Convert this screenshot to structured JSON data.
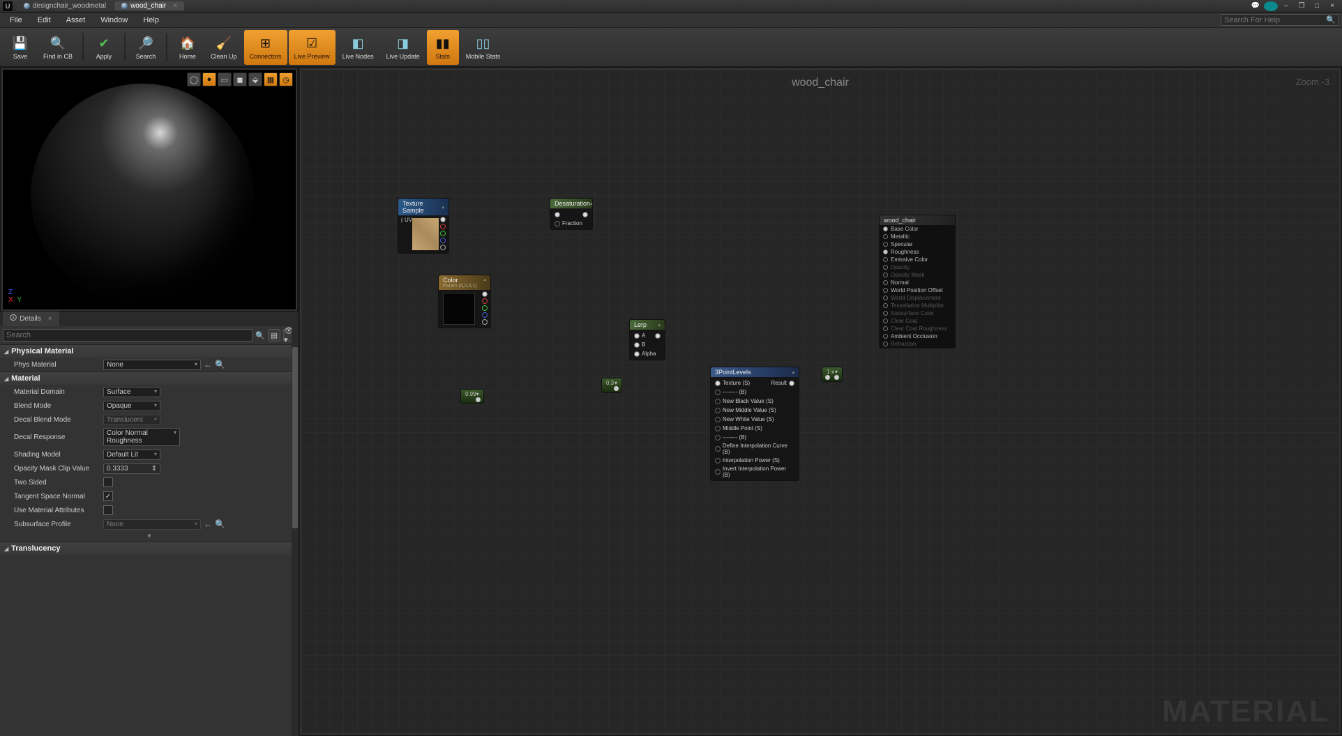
{
  "titlebar": {
    "tabs": [
      {
        "label": "designchair_woodmetal",
        "active": false
      },
      {
        "label": "wood_chair",
        "active": true
      }
    ]
  },
  "menubar": {
    "items": [
      "File",
      "Edit",
      "Asset",
      "Window",
      "Help"
    ],
    "search_placeholder": "Search For Help"
  },
  "toolbar": {
    "buttons": [
      {
        "label": "Save",
        "icon": "💾",
        "active": false
      },
      {
        "label": "Find in CB",
        "icon": "🔍",
        "active": false
      },
      {
        "label": "Apply",
        "icon": "✔",
        "active": false
      },
      {
        "label": "Search",
        "icon": "🔎",
        "active": false
      },
      {
        "label": "Home",
        "icon": "🏠",
        "active": false
      },
      {
        "label": "Clean Up",
        "icon": "🧹",
        "active": false
      },
      {
        "label": "Connectors",
        "icon": "⊞",
        "active": true
      },
      {
        "label": "Live Preview",
        "icon": "☑",
        "active": true
      },
      {
        "label": "Live Nodes",
        "icon": "◧",
        "active": false
      },
      {
        "label": "Live Update",
        "icon": "◨",
        "active": false
      },
      {
        "label": "Stats",
        "icon": "▮▮",
        "active": true
      },
      {
        "label": "Mobile Stats",
        "icon": "▯▯",
        "active": false
      }
    ]
  },
  "details_panel": {
    "tab_label": "Details",
    "search_placeholder": "Search",
    "sections": {
      "physical_material": {
        "title": "Physical Material",
        "phys_material": {
          "label": "Phys Material",
          "value": "None"
        }
      },
      "material": {
        "title": "Material",
        "material_domain": {
          "label": "Material Domain",
          "value": "Surface"
        },
        "blend_mode": {
          "label": "Blend Mode",
          "value": "Opaque"
        },
        "decal_blend_mode": {
          "label": "Decal Blend Mode",
          "value": "Translucent"
        },
        "decal_response": {
          "label": "Decal Response",
          "value": "Color Normal Roughness"
        },
        "shading_model": {
          "label": "Shading Model",
          "value": "Default Lit"
        },
        "opacity_mask_clip": {
          "label": "Opacity Mask Clip Value",
          "value": "0.3333"
        },
        "two_sided": {
          "label": "Two Sided",
          "checked": false
        },
        "tangent_space_normal": {
          "label": "Tangent Space Normal",
          "checked": true
        },
        "use_material_attributes": {
          "label": "Use Material Attributes",
          "checked": false
        },
        "subsurface_profile": {
          "label": "Subsurface Profile",
          "value": "None"
        }
      },
      "translucency": {
        "title": "Translucency"
      }
    }
  },
  "graph": {
    "title": "wood_chair",
    "zoom": "Zoom -3",
    "watermark": "MATERIAL",
    "nodes": {
      "texture_sample": {
        "title": "Texture Sample",
        "inputs": [
          "UVs"
        ],
        "outputs": [
          "",
          "",
          "",
          "",
          ""
        ]
      },
      "desaturation": {
        "title": "Desaturation",
        "inputs": [
          "",
          "Fraction"
        ]
      },
      "color": {
        "title": "Color",
        "sub": "Param (0,0,0,1)"
      },
      "lerp": {
        "title": "Lerp",
        "inputs": [
          "A",
          "B",
          "Alpha"
        ]
      },
      "const099": "0.99",
      "const03": "0.3",
      "oneminus": "1-x",
      "threepoint": {
        "title": "3PointLevels",
        "inputs": [
          "Texture (S)",
          "-------- (B)",
          "New Black Value (S)",
          "New Middle Value (S)",
          "New White Value (S)",
          "Middle Point (S)",
          "-------- (B)",
          "Define Interpolation Curve (B)",
          "Interpolation Power (S)",
          "Invert Interpolation Power (B)"
        ],
        "output": "Result"
      },
      "result": {
        "title": "wood_chair",
        "pins": [
          {
            "label": "Base Color",
            "on": true,
            "enabled": true
          },
          {
            "label": "Metallic",
            "on": false,
            "enabled": true
          },
          {
            "label": "Specular",
            "on": false,
            "enabled": true
          },
          {
            "label": "Roughness",
            "on": true,
            "enabled": true
          },
          {
            "label": "Emissive Color",
            "on": false,
            "enabled": true
          },
          {
            "label": "Opacity",
            "on": false,
            "enabled": false
          },
          {
            "label": "Opacity Mask",
            "on": false,
            "enabled": false
          },
          {
            "label": "Normal",
            "on": false,
            "enabled": true
          },
          {
            "label": "World Position Offset",
            "on": false,
            "enabled": true
          },
          {
            "label": "World Displacement",
            "on": false,
            "enabled": false
          },
          {
            "label": "Tessellation Multiplier",
            "on": false,
            "enabled": false
          },
          {
            "label": "Subsurface Color",
            "on": false,
            "enabled": false
          },
          {
            "label": "Clear Coat",
            "on": false,
            "enabled": false
          },
          {
            "label": "Clear Coat Roughness",
            "on": false,
            "enabled": false
          },
          {
            "label": "Ambient Occlusion",
            "on": false,
            "enabled": true
          },
          {
            "label": "Refraction",
            "on": false,
            "enabled": false
          }
        ]
      }
    }
  }
}
